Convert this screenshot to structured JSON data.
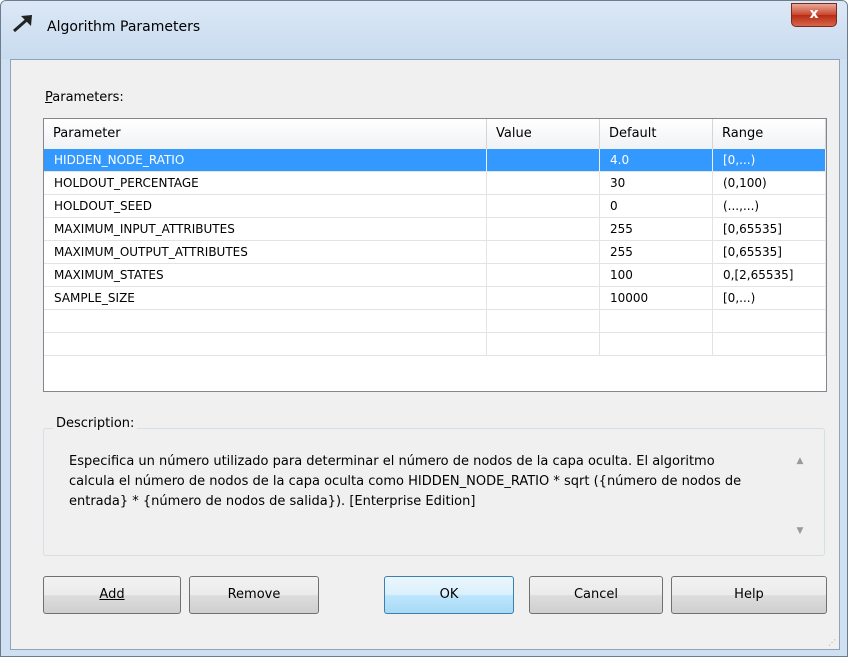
{
  "window": {
    "title": "Algorithm Parameters",
    "close_glyph": "x"
  },
  "parameters_label": {
    "mnemonic": "P",
    "rest": "arameters:"
  },
  "grid": {
    "columns": [
      "Parameter",
      "Value",
      "Default",
      "Range"
    ],
    "selected_index": 0,
    "rows": [
      {
        "parameter": "HIDDEN_NODE_RATIO",
        "value": "",
        "default": "4.0",
        "range": "[0,...)"
      },
      {
        "parameter": "HOLDOUT_PERCENTAGE",
        "value": "",
        "default": "30",
        "range": "(0,100)"
      },
      {
        "parameter": "HOLDOUT_SEED",
        "value": "",
        "default": "0",
        "range": "(...,...)"
      },
      {
        "parameter": "MAXIMUM_INPUT_ATTRIBUTES",
        "value": "",
        "default": "255",
        "range": "[0,65535]"
      },
      {
        "parameter": "MAXIMUM_OUTPUT_ATTRIBUTES",
        "value": "",
        "default": "255",
        "range": "[0,65535]"
      },
      {
        "parameter": "MAXIMUM_STATES",
        "value": "",
        "default": "100",
        "range": "0,[2,65535]"
      },
      {
        "parameter": "SAMPLE_SIZE",
        "value": "",
        "default": "10000",
        "range": "[0,...)"
      },
      {
        "parameter": "",
        "value": "",
        "default": "",
        "range": ""
      },
      {
        "parameter": "",
        "value": "",
        "default": "",
        "range": ""
      }
    ]
  },
  "description": {
    "label": "Description:",
    "text": "Especifica un número utilizado para determinar el número de nodos de la capa oculta. El algoritmo calcula el número de nodos de la capa oculta como HIDDEN_NODE_RATIO * sqrt ({número de nodos de entrada} * {número de nodos de salida}). [Enterprise Edition]"
  },
  "buttons": {
    "add": "Add",
    "remove": "Remove",
    "ok": "OK",
    "cancel": "Cancel",
    "help": "Help"
  },
  "colors": {
    "selection": "#3399ff",
    "title_bar": "#cfe0f3",
    "close": "#c9452c"
  }
}
